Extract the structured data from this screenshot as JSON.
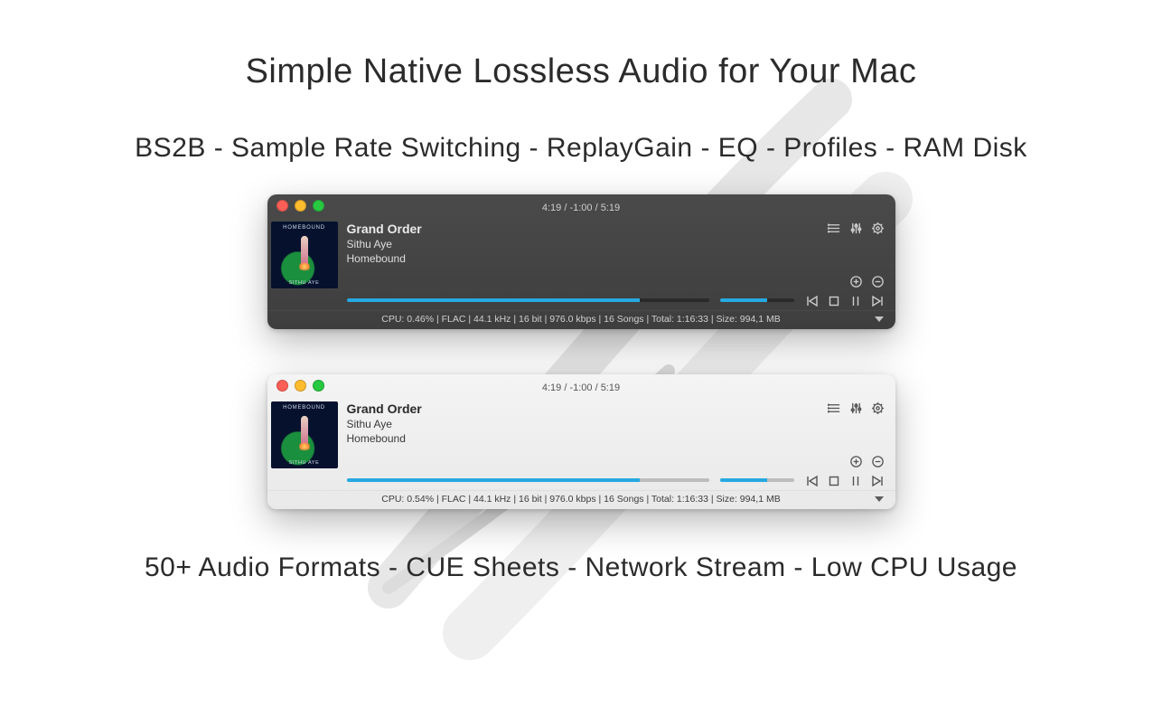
{
  "headline": "Simple Native Lossless Audio for Your Mac",
  "subhead": "BS2B - Sample Rate Switching - ReplayGain - EQ - Profiles - RAM Disk",
  "footline": "50+ Audio Formats - CUE Sheets - Network Stream - Low CPU Usage",
  "progress_percent": 81,
  "volume_percent": 64,
  "player_dark": {
    "time_display": "4:19 / -1:00 / 5:19",
    "track_title": "Grand Order",
    "artist": "Sithu Aye",
    "album": "Homebound",
    "album_art_top_label": "HOMEBOUND",
    "album_art_bottom_label": "SITHU AYE",
    "status": "CPU: 0.46% | FLAC | 44.1 kHz | 16 bit | 976.0 kbps | 16 Songs | Total: 1:16:33 | Size: 994,1 MB"
  },
  "player_light": {
    "time_display": "4:19 / -1:00 / 5:19",
    "track_title": "Grand Order",
    "artist": "Sithu Aye",
    "album": "Homebound",
    "album_art_top_label": "HOMEBOUND",
    "album_art_bottom_label": "SITHU AYE",
    "status": "CPU: 0.54% | FLAC | 44.1 kHz | 16 bit | 976.0 kbps | 16 Songs | Total: 1:16:33 | Size: 994,1 MB"
  }
}
